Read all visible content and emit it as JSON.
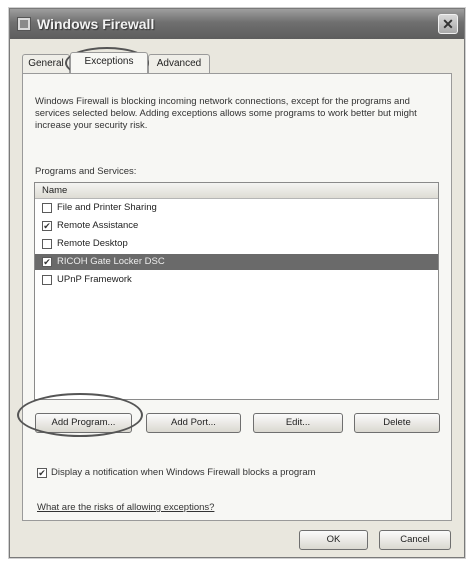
{
  "window": {
    "title": "Windows Firewall",
    "close_glyph": "✕"
  },
  "tabs": [
    {
      "label": "General"
    },
    {
      "label": "Exceptions"
    },
    {
      "label": "Advanced"
    }
  ],
  "description": "Windows Firewall is blocking incoming network connections, except for the programs and services selected below. Adding exceptions allows some programs to work better but might increase your security risk.",
  "programs": {
    "label": "Programs and Services:",
    "column_header": "Name",
    "items": [
      {
        "label": "File and Printer Sharing",
        "checked": false,
        "selected": false
      },
      {
        "label": "Remote Assistance",
        "checked": true,
        "selected": false
      },
      {
        "label": "Remote Desktop",
        "checked": false,
        "selected": false
      },
      {
        "label": "RICOH Gate Locker DSC",
        "checked": true,
        "selected": true
      },
      {
        "label": "UPnP Framework",
        "checked": false,
        "selected": false
      }
    ]
  },
  "buttons": {
    "add_program": "Add Program...",
    "add_port": "Add Port...",
    "edit": "Edit...",
    "delete": "Delete",
    "ok": "OK",
    "cancel": "Cancel"
  },
  "notification": {
    "label": "Display a notification when Windows Firewall blocks a program",
    "checked": true
  },
  "link": "What are the risks of allowing exceptions?",
  "check_glyph": "✔"
}
